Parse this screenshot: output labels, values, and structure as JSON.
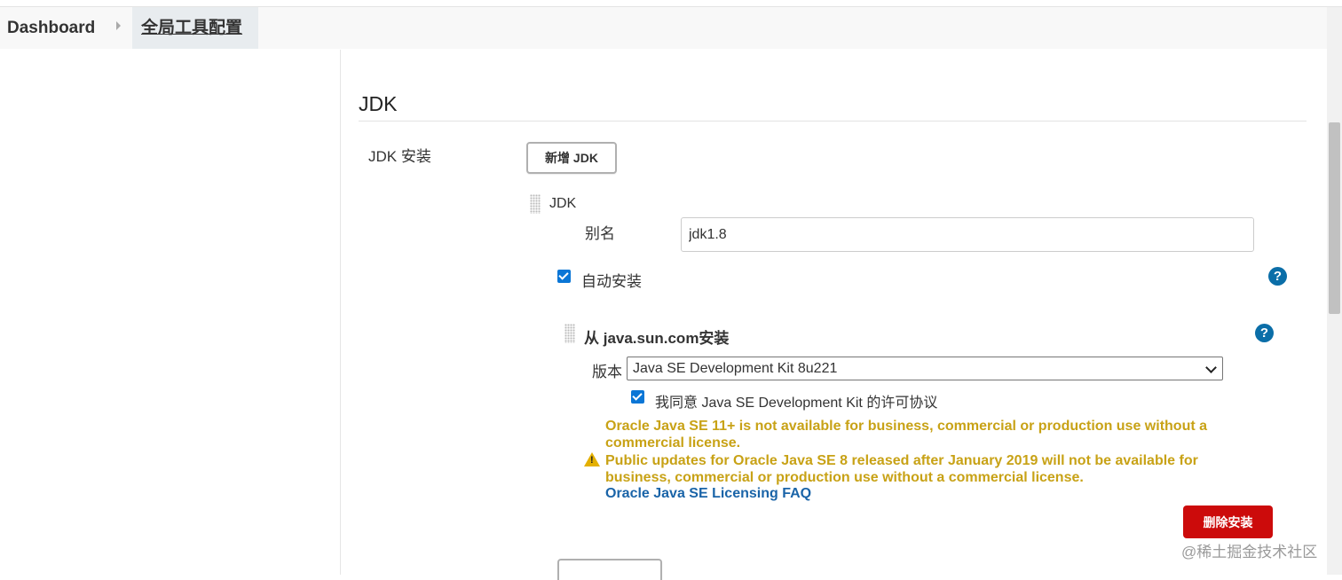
{
  "breadcrumb": {
    "items": [
      "Dashboard",
      "全局工具配置"
    ]
  },
  "section": {
    "title": "JDK",
    "install_label": "JDK 安装",
    "add_button_label": "新增 JDK"
  },
  "jdk_entry": {
    "header": "JDK",
    "alias_label": "别名",
    "alias_value": "jdk1.8",
    "auto_install_label": "自动安装",
    "auto_install_checked": true
  },
  "installer": {
    "title": "从 java.sun.com安装",
    "version_label": "版本",
    "version_value": "Java SE Development Kit 8u221",
    "agree_label": "我同意 Java SE Development Kit 的许可协议",
    "agree_checked": true,
    "warning_line1": "Oracle Java SE 11+ is not available for business, commercial or production use without a",
    "warning_line2": "commercial license.",
    "warning_line3": "Public updates for Oracle Java SE 8 released after January 2019 will not be available for",
    "warning_line4": "business, commercial or production use without a commercial license.",
    "faq_link": "Oracle Java SE Licensing FAQ",
    "delete_button_label": "删除安装"
  },
  "help_icon_glyph": "?",
  "warning_glyph": "!",
  "watermark": "@稀土掘金技术社区",
  "colors": {
    "accent": "#0a76d6",
    "help": "#0b6ea8",
    "warning": "#c8a216",
    "danger": "#cc0b0b",
    "link": "#1a64a8"
  }
}
